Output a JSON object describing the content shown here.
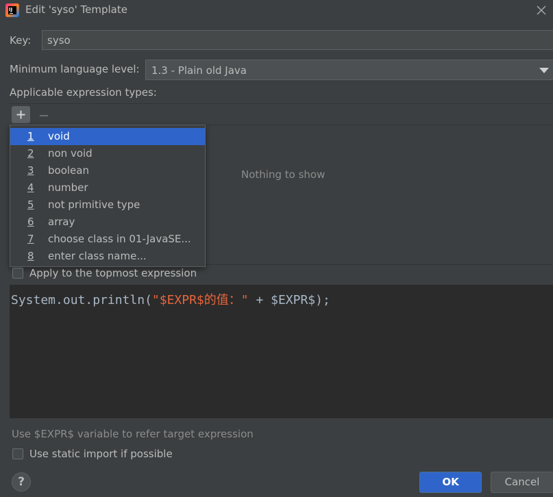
{
  "window": {
    "title": "Edit 'syso' Template",
    "app_icon_text": "IJ"
  },
  "key": {
    "label": "Key:",
    "value": "syso"
  },
  "language_level": {
    "label": "Minimum language level:",
    "selected": "1.3 - Plain old Java"
  },
  "expression_types": {
    "label": "Applicable expression types:",
    "empty_text": "Nothing to show"
  },
  "popup": {
    "items": [
      {
        "num": "1",
        "label": "void",
        "selected": true
      },
      {
        "num": "2",
        "label": "non void"
      },
      {
        "num": "3",
        "label": "boolean"
      },
      {
        "num": "4",
        "label": "number"
      },
      {
        "num": "5",
        "label": "not primitive type"
      },
      {
        "num": "6",
        "label": "array"
      },
      {
        "num": "7",
        "label": "choose class in 01-JavaSE..."
      },
      {
        "num": "8",
        "label": "enter class name..."
      }
    ]
  },
  "options": {
    "topmost": "Apply to the topmost expression",
    "static_import": "Use static import if possible"
  },
  "editor": {
    "code_prefix": "System.out.println(",
    "code_string": "\"$EXPR$的值：\"",
    "code_suffix": " + $EXPR$);"
  },
  "hint": "Use $EXPR$ variable to refer target expression",
  "buttons": {
    "help": "?",
    "ok": "OK",
    "cancel": "Cancel"
  },
  "colors": {
    "accent": "#2f65ca",
    "background": "#3c3f41",
    "editor_bg": "#2b2b2b",
    "string": "#e9653b"
  }
}
